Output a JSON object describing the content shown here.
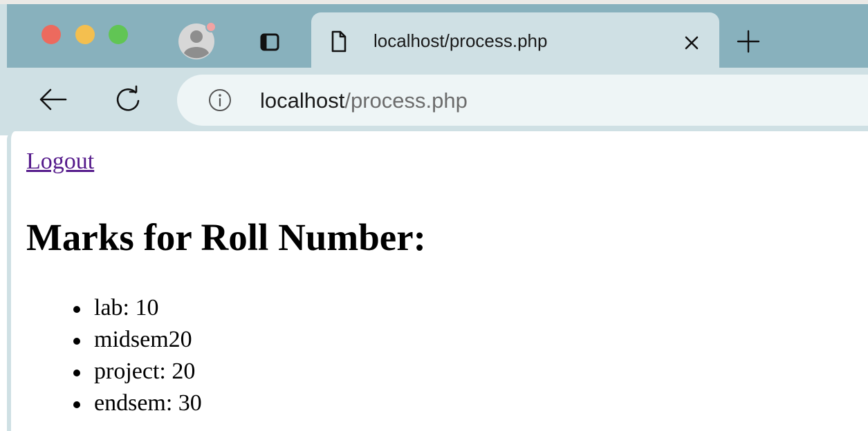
{
  "browser": {
    "tab": {
      "title": "localhost/process.php"
    },
    "address_bar": {
      "host": "localhost",
      "path": "/process.php"
    },
    "icons": {
      "close": "close-icon",
      "new_tab": "plus-icon",
      "back": "arrow-left-icon",
      "reload": "reload-icon",
      "site_info": "info-icon",
      "document": "document-icon",
      "tab_overview": "tab-overview-icon",
      "profile": "profile-avatar-icon"
    },
    "colors": {
      "tabstrip": "#88b1bd",
      "toolbar": "#cfe0e4",
      "close_light": "#ec6a5e",
      "minimize_light": "#f4bf4f",
      "zoom_light": "#61c554",
      "link_visited": "#551a8b"
    }
  },
  "page": {
    "logout_label": "Logout",
    "heading": "Marks for Roll Number:",
    "marks": [
      "lab: 10",
      "midsem20",
      "project: 20",
      "endsem: 30"
    ]
  }
}
